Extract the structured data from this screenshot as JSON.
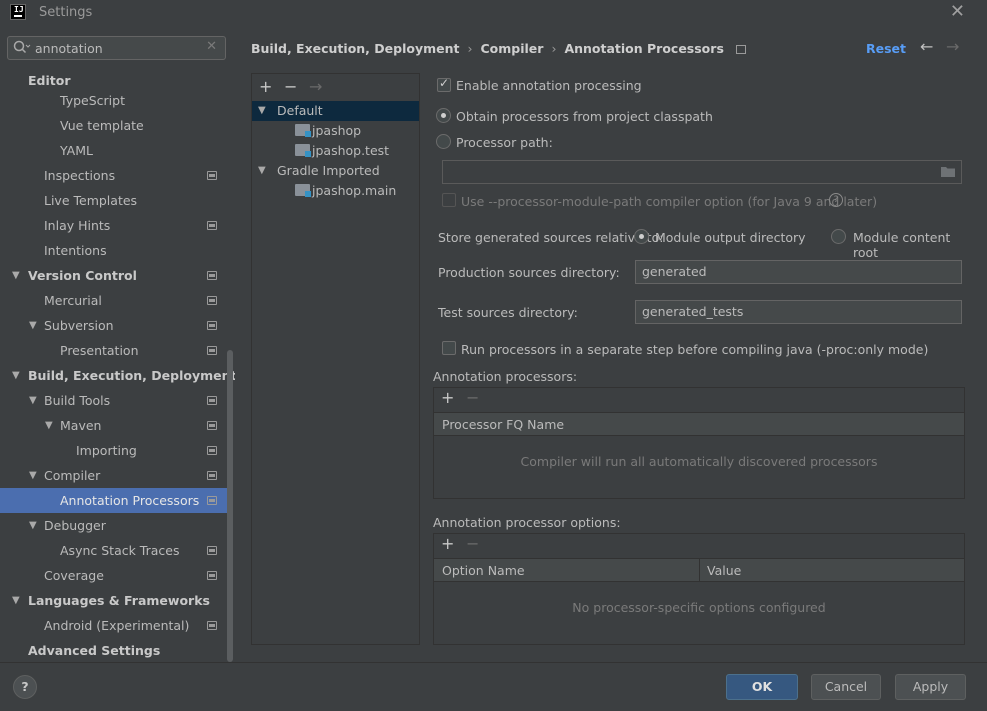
{
  "window": {
    "title": "Settings"
  },
  "search": {
    "value": "annotation"
  },
  "sidebar": {
    "items": [
      {
        "label": "Editor",
        "bold": true
      },
      {
        "label": "TypeScript"
      },
      {
        "label": "Vue template"
      },
      {
        "label": "YAML"
      },
      {
        "label": "Inspections"
      },
      {
        "label": "Live Templates"
      },
      {
        "label": "Inlay Hints"
      },
      {
        "label": "Intentions"
      },
      {
        "label": "Version Control"
      },
      {
        "label": "Mercurial"
      },
      {
        "label": "Subversion"
      },
      {
        "label": "Presentation"
      },
      {
        "label": "Build, Execution, Deployment"
      },
      {
        "label": "Build Tools"
      },
      {
        "label": "Maven"
      },
      {
        "label": "Importing"
      },
      {
        "label": "Compiler"
      },
      {
        "label": "Annotation Processors"
      },
      {
        "label": "Debugger"
      },
      {
        "label": "Async Stack Traces"
      },
      {
        "label": "Coverage"
      },
      {
        "label": "Languages & Frameworks"
      },
      {
        "label": "Android (Experimental)"
      },
      {
        "label": "Advanced Settings"
      }
    ]
  },
  "breadcrumb": [
    "Build, Execution, Deployment",
    "Compiler",
    "Annotation Processors"
  ],
  "header": {
    "reset_label": "Reset"
  },
  "module_tree": {
    "items": [
      "Default",
      "jpashop",
      "jpashop.test",
      "Gradle Imported",
      "jpashop.main"
    ]
  },
  "form": {
    "enable_processing": "Enable annotation processing",
    "obtain_classpath": "Obtain processors from project classpath",
    "processor_path": "Processor path:",
    "processor_path_value": "",
    "use_module_path": "Use --processor-module-path compiler option (for Java 9 and later)",
    "store_relative": "Store generated sources relative to:",
    "module_output": "Module output directory",
    "module_content": "Module content root",
    "prod_dir_label": "Production sources directory:",
    "prod_dir_value": "generated",
    "test_dir_label": "Test sources directory:",
    "test_dir_value": "generated_tests",
    "run_separate": "Run processors in a separate step before compiling java (-proc:only mode)",
    "processors_title": "Annotation processors:",
    "processors_col": "Processor FQ Name",
    "processors_empty": "Compiler will run all automatically discovered processors",
    "options_title": "Annotation processor options:",
    "options_col_name": "Option Name",
    "options_col_value": "Value",
    "options_empty": "No processor-specific options configured"
  },
  "footer": {
    "help": "?",
    "ok": "OK",
    "cancel": "Cancel",
    "apply": "Apply"
  }
}
